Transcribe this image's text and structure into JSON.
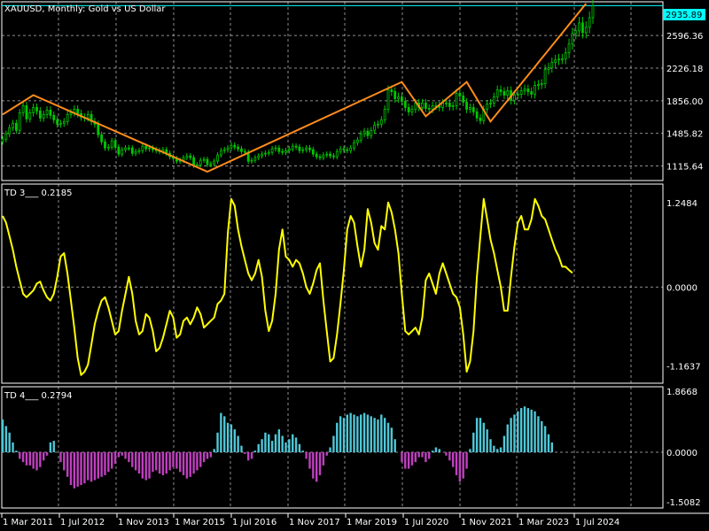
{
  "header": {
    "title": "XAUUSD, Monthly:  Gold vs US Dollar"
  },
  "current_price_tag": "2935.89",
  "colors": {
    "background": "#000000",
    "grid": "#FFFFFF",
    "candle_up": "#00C800",
    "zigzag": "#FF8C1A",
    "td3_line": "#FFFF00",
    "td4_positive": "#4FC8D8",
    "td4_negative": "#C040C0",
    "price_tag": "#00FFFF"
  },
  "x_axis_labels": [
    "1 Mar 2011",
    "1 Jul 2012",
    "1 Nov 2013",
    "1 Mar 2015",
    "1 Jul 2016",
    "1 Nov 2017",
    "1 Mar 2019",
    "1 Jul 2020",
    "1 Nov 2021",
    "1 Mar 2023",
    "1 Jul 2024"
  ],
  "chart_data": [
    {
      "type": "line",
      "panel": "price",
      "scale_labels": [
        "2596.36",
        "2226.18",
        "1856.00",
        "1485.82",
        "1115.64"
      ],
      "ylim": [
        950,
        2980
      ],
      "candles_close": [
        1420,
        1480,
        1550,
        1600,
        1520,
        1720,
        1800,
        1650,
        1720,
        1780,
        1740,
        1660,
        1700,
        1750,
        1690,
        1640,
        1590,
        1600,
        1620,
        1700,
        1720,
        1760,
        1710,
        1670,
        1660,
        1700,
        1620,
        1590,
        1470,
        1390,
        1320,
        1330,
        1400,
        1330,
        1250,
        1300,
        1320,
        1320,
        1260,
        1280,
        1290,
        1340,
        1310,
        1320,
        1300,
        1290,
        1280,
        1300,
        1260,
        1220,
        1200,
        1170,
        1180,
        1210,
        1230,
        1210,
        1120,
        1130,
        1180,
        1190,
        1130,
        1140,
        1170,
        1240,
        1290,
        1300,
        1320,
        1350,
        1330,
        1310,
        1280,
        1270,
        1170,
        1180,
        1210,
        1230,
        1250,
        1260,
        1270,
        1310,
        1320,
        1280,
        1270,
        1290,
        1310,
        1340,
        1330,
        1290,
        1300,
        1320,
        1300,
        1250,
        1220,
        1210,
        1240,
        1250,
        1230,
        1220,
        1280,
        1310,
        1300,
        1290,
        1320,
        1380,
        1410,
        1480,
        1510,
        1460,
        1520,
        1580,
        1590,
        1640,
        1760,
        1980,
        1960,
        1880,
        1900,
        1850,
        1780,
        1730,
        1760,
        1830,
        1780,
        1830,
        1770,
        1760,
        1800,
        1800,
        1780,
        1830,
        1830,
        1790,
        1800,
        1940,
        1910,
        1840,
        1760,
        1780,
        1730,
        1660,
        1630,
        1760,
        1820,
        1830,
        1900,
        1980,
        1960,
        1920,
        1970,
        1860,
        1920,
        1930,
        1970,
        1990,
        1960,
        1930,
        2030,
        2040,
        2050,
        2210,
        2230,
        2290,
        2320,
        2330,
        2330,
        2400,
        2500,
        2620,
        2650,
        2740,
        2630,
        2690,
        2800,
        2935.89
      ],
      "zigzag": [
        {
          "x": "2010-11",
          "y": 1700
        },
        {
          "x": "2011-08",
          "y": 1920
        },
        {
          "x": "2015-11",
          "y": 1050
        },
        {
          "x": "2020-08",
          "y": 2070
        },
        {
          "x": "2021-03",
          "y": 1680
        },
        {
          "x": "2022-03",
          "y": 2070
        },
        {
          "x": "2022-10",
          "y": 1620
        },
        {
          "x": "2025-02",
          "y": 2960
        }
      ]
    },
    {
      "type": "line",
      "panel": "TD 3",
      "name": "TD 3___ 0.2185",
      "scale_labels": [
        "1.2484",
        "0.0000",
        "-1.1637"
      ],
      "ylim": [
        -1.42,
        1.52
      ],
      "values": [
        1.05,
        0.95,
        0.75,
        0.55,
        0.3,
        0.1,
        -0.1,
        -0.15,
        -0.1,
        -0.05,
        0.05,
        0.08,
        -0.05,
        -0.15,
        -0.2,
        -0.1,
        0.15,
        0.45,
        0.5,
        0.2,
        -0.2,
        -0.6,
        -1.05,
        -1.3,
        -1.25,
        -1.15,
        -0.85,
        -0.55,
        -0.35,
        -0.2,
        -0.15,
        -0.3,
        -0.5,
        -0.7,
        -0.65,
        -0.35,
        -0.1,
        0.15,
        -0.1,
        -0.5,
        -0.7,
        -0.65,
        -0.4,
        -0.45,
        -0.65,
        -0.95,
        -0.9,
        -0.75,
        -0.55,
        -0.35,
        -0.45,
        -0.75,
        -0.7,
        -0.5,
        -0.45,
        -0.55,
        -0.45,
        -0.3,
        -0.4,
        -0.6,
        -0.55,
        -0.5,
        -0.45,
        -0.25,
        -0.2,
        -0.1,
        0.8,
        1.3,
        1.2,
        0.85,
        0.6,
        0.4,
        0.2,
        0.1,
        0.2,
        0.4,
        0.15,
        -0.35,
        -0.65,
        -0.5,
        -0.1,
        0.55,
        0.85,
        0.45,
        0.4,
        0.3,
        0.4,
        0.35,
        0.2,
        0.0,
        -0.1,
        0.05,
        0.25,
        0.35,
        -0.2,
        -0.65,
        -1.1,
        -1.05,
        -0.7,
        -0.25,
        0.25,
        0.85,
        1.05,
        0.95,
        0.6,
        0.3,
        0.55,
        1.15,
        0.95,
        0.65,
        0.55,
        0.9,
        0.85,
        1.25,
        1.1,
        0.85,
        0.5,
        -0.1,
        -0.65,
        -0.7,
        -0.65,
        -0.6,
        -0.7,
        -0.45,
        0.1,
        0.2,
        0.05,
        -0.1,
        0.2,
        0.35,
        0.2,
        0.05,
        -0.1,
        -0.15,
        -0.3,
        -0.7,
        -1.25,
        -1.1,
        -0.65,
        0.15,
        0.75,
        1.3,
        1.0,
        0.7,
        0.5,
        0.25,
        0.0,
        -0.35,
        -0.35,
        0.15,
        0.6,
        0.95,
        1.05,
        0.85,
        0.85,
        1.0,
        1.3,
        1.2,
        1.05,
        1.0,
        0.85,
        0.7,
        0.55,
        0.45,
        0.3,
        0.3,
        0.25,
        0.21
      ]
    },
    {
      "type": "bar",
      "panel": "TD 4",
      "name": "TD 4___ 0.2794",
      "scale_labels": [
        "1.8668",
        "0.0000",
        "-1.5082"
      ],
      "ylim": [
        -1.7,
        2.0
      ],
      "values": [
        1.0,
        0.8,
        0.6,
        0.3,
        0.05,
        -0.2,
        -0.3,
        -0.4,
        -0.4,
        -0.5,
        -0.55,
        -0.45,
        -0.25,
        -0.1,
        0.3,
        0.35,
        0.0,
        -0.3,
        -0.55,
        -0.75,
        -1.0,
        -1.1,
        -1.05,
        -1.0,
        -0.95,
        -0.85,
        -0.9,
        -0.85,
        -0.8,
        -0.75,
        -0.7,
        -0.6,
        -0.5,
        -0.35,
        -0.15,
        -0.1,
        -0.2,
        -0.3,
        -0.45,
        -0.55,
        -0.65,
        -0.8,
        -0.85,
        -0.8,
        -0.6,
        -0.55,
        -0.65,
        -0.7,
        -0.65,
        -0.55,
        -0.45,
        -0.5,
        -0.6,
        -0.7,
        -0.8,
        -0.75,
        -0.65,
        -0.55,
        -0.45,
        -0.3,
        -0.2,
        -0.15,
        0.1,
        0.6,
        1.2,
        1.1,
        0.9,
        0.85,
        0.7,
        0.5,
        0.2,
        -0.05,
        -0.25,
        -0.2,
        0.05,
        0.25,
        0.4,
        0.6,
        0.55,
        0.35,
        0.55,
        0.7,
        0.5,
        0.3,
        0.4,
        0.55,
        0.45,
        0.25,
        0.05,
        -0.2,
        -0.5,
        -0.8,
        -0.9,
        -0.7,
        -0.4,
        -0.1,
        0.15,
        0.5,
        0.9,
        1.1,
        1.05,
        1.15,
        1.2,
        1.15,
        1.1,
        1.15,
        1.2,
        1.15,
        1.1,
        1.05,
        1.0,
        1.15,
        1.05,
        0.9,
        0.75,
        0.4,
        0.0,
        -0.3,
        -0.5,
        -0.5,
        -0.4,
        -0.3,
        -0.15,
        -0.15,
        -0.3,
        -0.2,
        0.05,
        0.15,
        0.1,
        0.0,
        -0.1,
        -0.25,
        -0.45,
        -0.7,
        -0.9,
        -0.8,
        -0.5,
        0.1,
        0.6,
        1.05,
        1.05,
        0.9,
        0.7,
        0.4,
        0.2,
        0.1,
        0.15,
        0.5,
        0.85,
        1.05,
        1.15,
        1.25,
        1.35,
        1.4,
        1.35,
        1.3,
        1.25,
        1.1,
        0.95,
        0.8,
        0.55,
        0.3
      ]
    }
  ]
}
